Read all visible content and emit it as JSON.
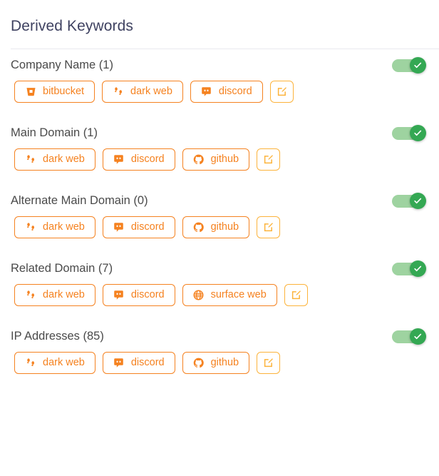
{
  "panel": {
    "title": "Derived Keywords"
  },
  "colors": {
    "accent_orange": "#f58220",
    "edit_amber": "#fcb33b",
    "toggle_green": "#34a853",
    "toggle_track_green": "#9ed3a0",
    "title_navy": "#3f4261",
    "label_gray": "#4a4a4a",
    "divider_gray": "#e9e9ef"
  },
  "sections": [
    {
      "label": "Company Name (1)",
      "toggle": {
        "name": "toggle-company-name",
        "state": "on",
        "icon": "check-icon"
      },
      "chips": [
        {
          "label": "bitbucket",
          "icon": "bitbucket-icon"
        },
        {
          "label": "dark web",
          "icon": "dark-web-footprints-icon"
        },
        {
          "label": "discord",
          "icon": "discord-icon"
        }
      ],
      "edit": {
        "name": "edit-company-name-button",
        "icon": "edit-pencil-icon"
      }
    },
    {
      "label": "Main Domain (1)",
      "toggle": {
        "name": "toggle-main-domain",
        "state": "on",
        "icon": "check-icon"
      },
      "chips": [
        {
          "label": "dark web",
          "icon": "dark-web-footprints-icon"
        },
        {
          "label": "discord",
          "icon": "discord-icon"
        },
        {
          "label": "github",
          "icon": "github-icon"
        }
      ],
      "edit": {
        "name": "edit-main-domain-button",
        "icon": "edit-pencil-icon"
      }
    },
    {
      "label": "Alternate Main Domain (0)",
      "toggle": {
        "name": "toggle-alternate-main-domain",
        "state": "on",
        "icon": "check-icon"
      },
      "chips": [
        {
          "label": "dark web",
          "icon": "dark-web-footprints-icon"
        },
        {
          "label": "discord",
          "icon": "discord-icon"
        },
        {
          "label": "github",
          "icon": "github-icon"
        }
      ],
      "edit": {
        "name": "edit-alternate-main-domain-button",
        "icon": "edit-pencil-icon"
      }
    },
    {
      "label": "Related Domain (7)",
      "toggle": {
        "name": "toggle-related-domain",
        "state": "on",
        "icon": "check-icon"
      },
      "chips": [
        {
          "label": "dark web",
          "icon": "dark-web-footprints-icon"
        },
        {
          "label": "discord",
          "icon": "discord-icon"
        },
        {
          "label": "surface web",
          "icon": "globe-icon"
        }
      ],
      "edit": {
        "name": "edit-related-domain-button",
        "icon": "edit-pencil-icon"
      }
    },
    {
      "label": "IP Addresses (85)",
      "toggle": {
        "name": "toggle-ip-addresses",
        "state": "on",
        "icon": "check-icon"
      },
      "chips": [
        {
          "label": "dark web",
          "icon": "dark-web-footprints-icon"
        },
        {
          "label": "discord",
          "icon": "discord-icon"
        },
        {
          "label": "github",
          "icon": "github-icon"
        }
      ],
      "edit": {
        "name": "edit-ip-addresses-button",
        "icon": "edit-pencil-icon"
      }
    }
  ]
}
